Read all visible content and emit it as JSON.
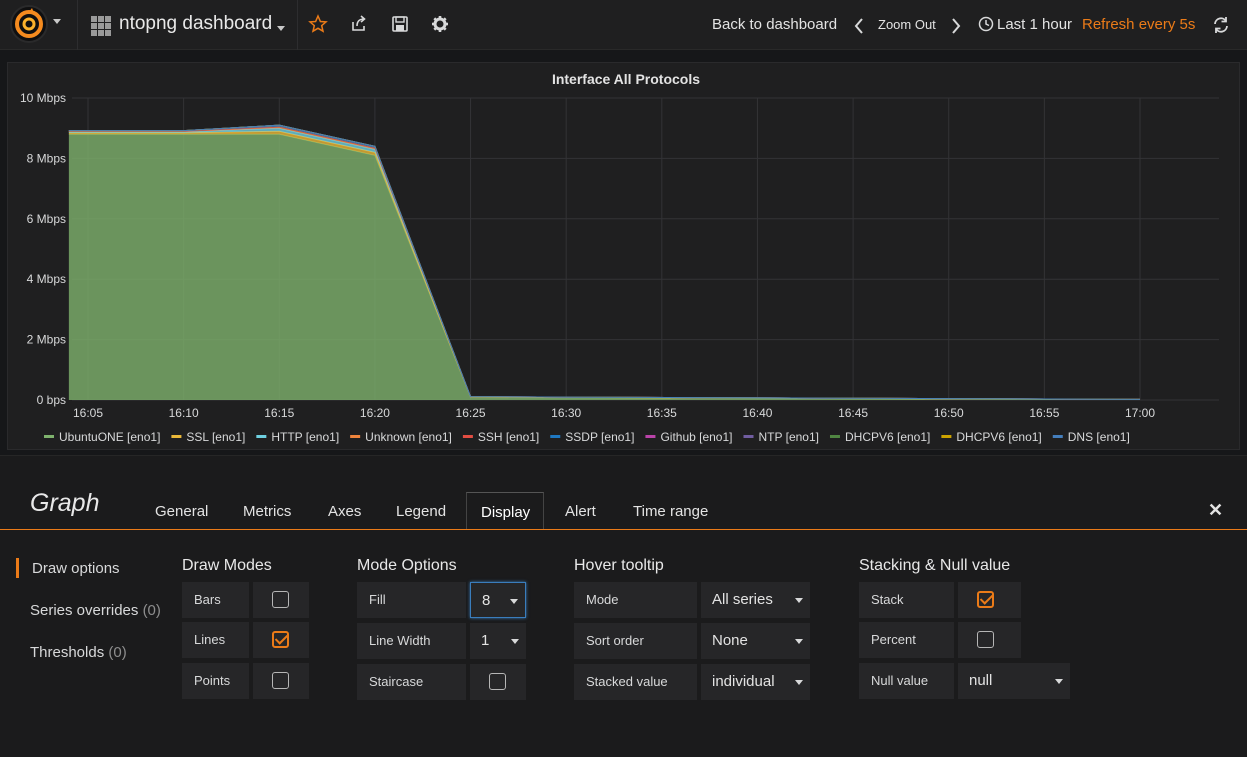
{
  "navbar": {
    "dashboard_title": "ntopng dashboard",
    "back_to_dashboard": "Back to dashboard",
    "zoom_out": "Zoom Out",
    "time_range": "Last 1 hour",
    "refresh": "Refresh every 5s"
  },
  "panel": {
    "title": "Interface All Protocols"
  },
  "chart_data": {
    "type": "area",
    "title": "Interface All Protocols",
    "x": [
      "16:05",
      "16:10",
      "16:15",
      "16:20",
      "16:25",
      "16:30",
      "16:35",
      "16:40",
      "16:45",
      "16:50",
      "16:55",
      "17:00"
    ],
    "y_ticks": [
      "0 bps",
      "2 Mbps",
      "4 Mbps",
      "6 Mbps",
      "8 Mbps",
      "10 Mbps"
    ],
    "ylim": [
      0,
      10
    ],
    "y_unit": "Mbps",
    "stacked": true,
    "grid": true,
    "legend_position": "bottom",
    "series": [
      {
        "name": "UbuntuONE [eno1]",
        "color": "#7eb26d",
        "x": [
          "16:04",
          "16:10",
          "16:15",
          "16:20",
          "16:25",
          "17:00"
        ],
        "values": [
          8.8,
          8.8,
          8.8,
          8.1,
          0.08,
          0.02
        ]
      },
      {
        "name": "SSL [eno1]",
        "color": "#eab839",
        "x": [
          "16:04",
          "16:10",
          "16:15",
          "16:20",
          "16:25",
          "17:00"
        ],
        "values": [
          0.05,
          0.05,
          0.1,
          0.1,
          0.02,
          0.0
        ]
      },
      {
        "name": "HTTP [eno1]",
        "color": "#6ed0e0",
        "x": [
          "16:04",
          "16:10",
          "16:15",
          "16:20",
          "16:25",
          "17:00"
        ],
        "values": [
          0.03,
          0.03,
          0.1,
          0.1,
          0.01,
          0.0
        ]
      },
      {
        "name": "Unknown [eno1]",
        "color": "#ef843c",
        "x": [
          "16:04",
          "16:10",
          "16:15",
          "16:20",
          "16:25",
          "17:00"
        ],
        "values": [
          0.02,
          0.02,
          0.05,
          0.05,
          0.0,
          0.0
        ]
      },
      {
        "name": "SSH [eno1]",
        "color": "#e24d42",
        "x": [
          "16:04",
          "17:00"
        ],
        "values": [
          0.0,
          0.0
        ]
      },
      {
        "name": "SSDP [eno1]",
        "color": "#1f78c1",
        "x": [
          "16:04",
          "16:10",
          "16:15",
          "16:20",
          "16:25",
          "17:00"
        ],
        "values": [
          0.02,
          0.02,
          0.05,
          0.05,
          0.0,
          0.0
        ]
      },
      {
        "name": "Github [eno1]",
        "color": "#ba43a9",
        "x": [
          "16:04",
          "17:00"
        ],
        "values": [
          0.0,
          0.0
        ]
      },
      {
        "name": "NTP [eno1]",
        "color": "#705da0",
        "x": [
          "16:04",
          "17:00"
        ],
        "values": [
          0.0,
          0.0
        ]
      },
      {
        "name": "DHCPV6 [eno1]",
        "color": "#508642",
        "x": [
          "16:04",
          "17:00"
        ],
        "values": [
          0.0,
          0.0
        ]
      },
      {
        "name": "DHCPV6 [eno1]",
        "color": "#cca300",
        "x": [
          "16:04",
          "17:00"
        ],
        "values": [
          0.0,
          0.0
        ]
      },
      {
        "name": "DNS [eno1]",
        "color": "#447ebc",
        "x": [
          "16:04",
          "17:00"
        ],
        "values": [
          0.0,
          0.0
        ]
      }
    ]
  },
  "editor": {
    "title": "Graph",
    "tabs": [
      "General",
      "Metrics",
      "Axes",
      "Legend",
      "Display",
      "Alert",
      "Time range"
    ],
    "active_tab": "Display",
    "side_items": [
      {
        "label": "Draw options",
        "count": ""
      },
      {
        "label": "Series overrides",
        "count": "(0)"
      },
      {
        "label": "Thresholds",
        "count": "(0)"
      }
    ],
    "draw_modes": {
      "title": "Draw Modes",
      "bars": {
        "label": "Bars",
        "checked": false
      },
      "lines": {
        "label": "Lines",
        "checked": true
      },
      "points": {
        "label": "Points",
        "checked": false
      }
    },
    "mode_options": {
      "title": "Mode Options",
      "fill": {
        "label": "Fill",
        "value": "8"
      },
      "line_width": {
        "label": "Line Width",
        "value": "1"
      },
      "staircase": {
        "label": "Staircase",
        "checked": false
      }
    },
    "hover_tooltip": {
      "title": "Hover tooltip",
      "mode": {
        "label": "Mode",
        "value": "All series"
      },
      "sort_order": {
        "label": "Sort order",
        "value": "None"
      },
      "stacked_value": {
        "label": "Stacked value",
        "value": "individual"
      }
    },
    "stacking": {
      "title": "Stacking & Null value",
      "stack": {
        "label": "Stack",
        "checked": true
      },
      "percent": {
        "label": "Percent",
        "checked": false
      },
      "null_value": {
        "label": "Null value",
        "value": "null"
      }
    }
  }
}
